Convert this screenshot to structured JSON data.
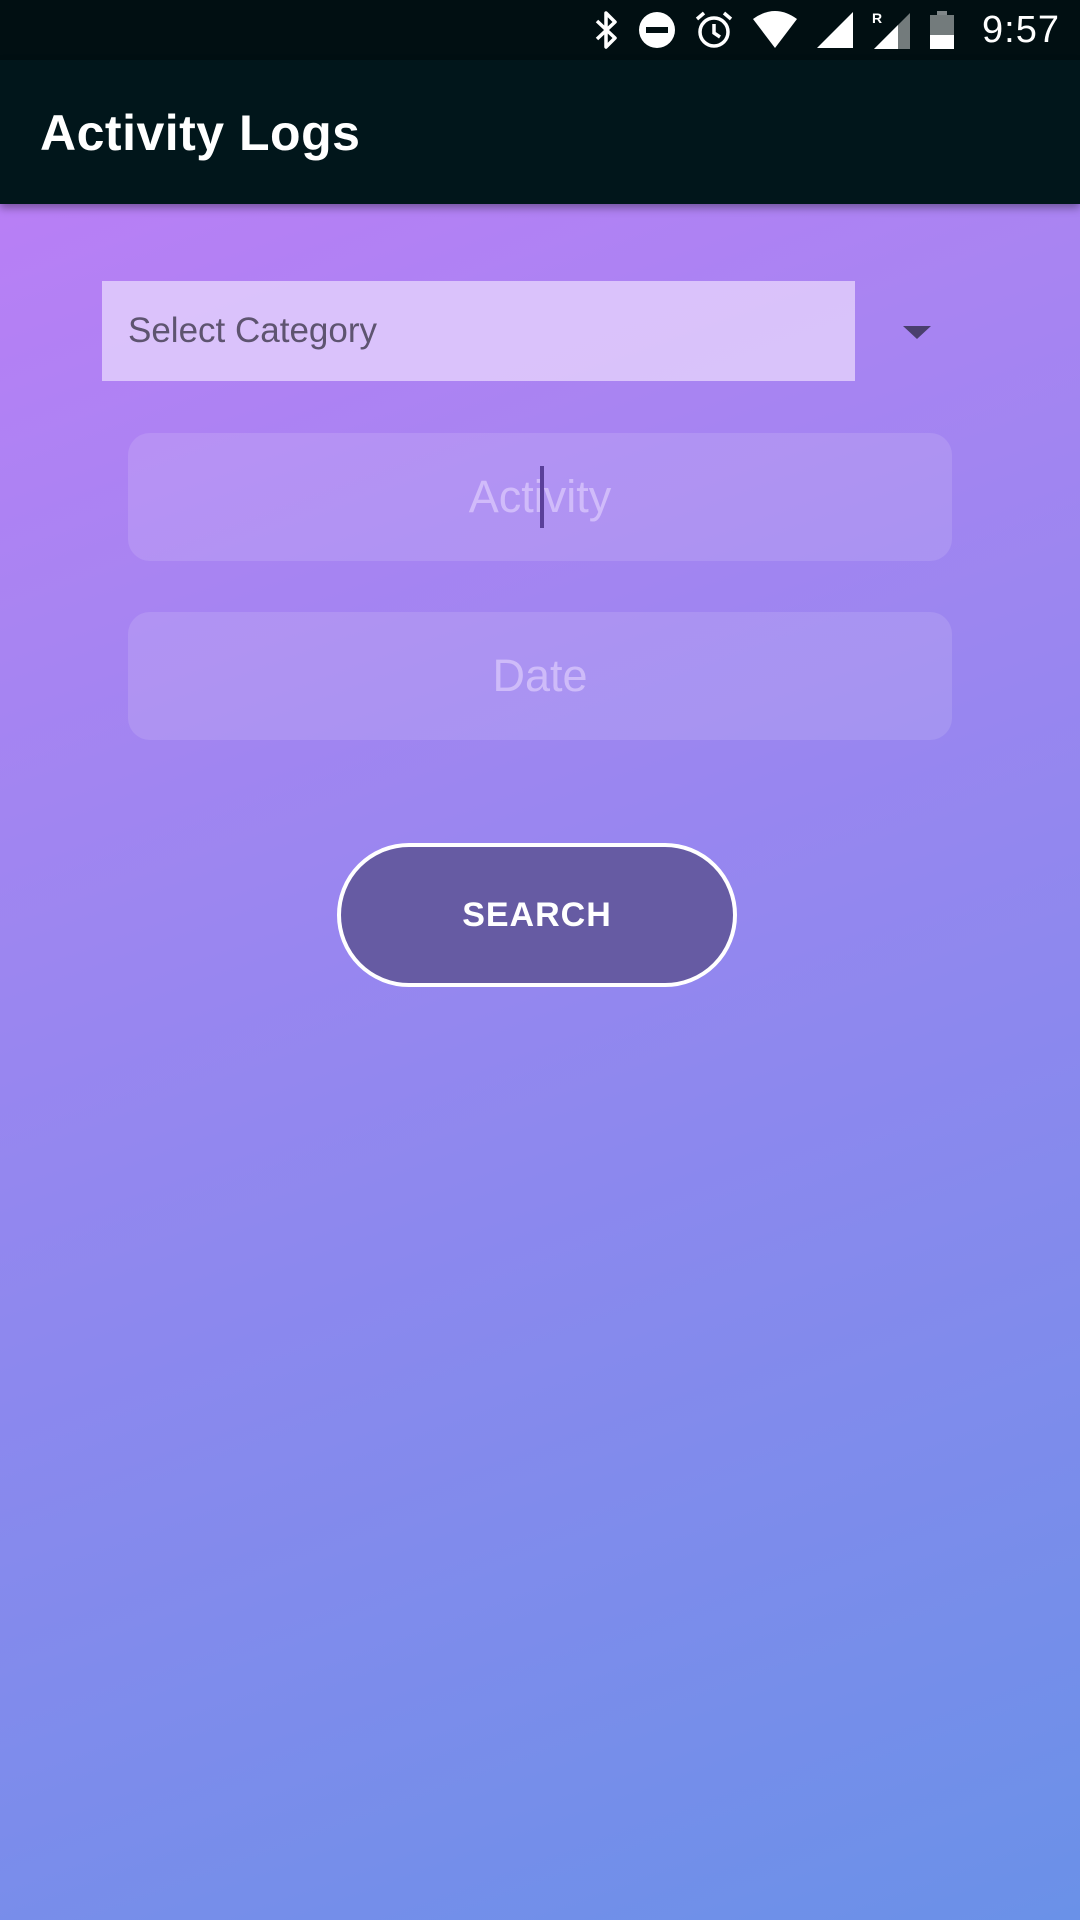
{
  "status_bar": {
    "time": "9:57",
    "icons": [
      "bluetooth-icon",
      "do-not-disturb-icon",
      "alarm-icon",
      "wifi-icon",
      "cell-signal-icon",
      "roaming-signal-icon",
      "battery-icon"
    ],
    "roaming_label": "R"
  },
  "app_bar": {
    "title": "Activity Logs"
  },
  "form": {
    "category_placeholder": "Select Category",
    "activity_placeholder": "Activity",
    "date_placeholder": "Date",
    "search_label": "SEARCH"
  },
  "colors": {
    "status_bar_bg": "#010f12",
    "app_bar_bg": "#01161b",
    "gradient_top": "#c07cf7",
    "gradient_bottom": "#6a91e8",
    "button_bg": "#665ba3"
  }
}
